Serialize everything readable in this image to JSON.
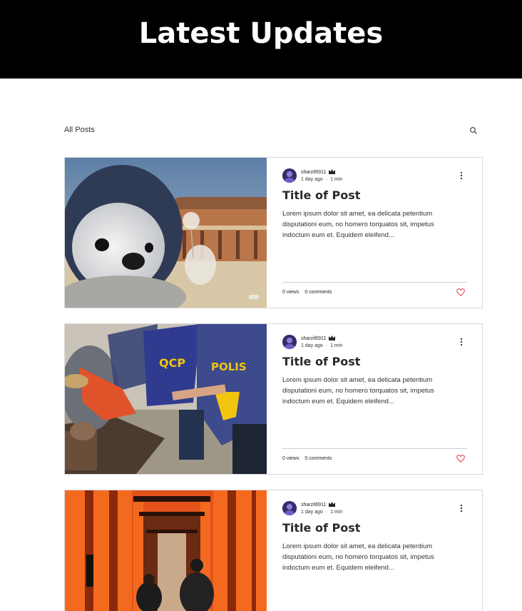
{
  "header": {
    "title": "Latest Updates"
  },
  "nav": {
    "all_posts": "All Posts",
    "search_icon": "search-icon"
  },
  "posts": [
    {
      "author": "sharzil6911",
      "time": "1 day ago",
      "read": "1 min",
      "title": "Title of Post",
      "excerpt": "Lorem ipsum dolor sit amet, ea delicata petentium disputationi eum, no homero torquatos sit, impetus indoctum eum et. Equidem eleifend...",
      "views": "0 views",
      "comments": "0 comments",
      "image": "penguin-photo"
    },
    {
      "author": "sharzil6911",
      "time": "1 day ago",
      "read": "1 min",
      "title": "Title of Post",
      "excerpt": "Lorem ipsum dolor sit amet, ea delicata petentium disputationi eum, no homero torquatos sit, impetus indoctum eum et. Equidem eleifend...",
      "views": "0 views",
      "comments": "0 comments",
      "image": "riot-police-photo"
    },
    {
      "author": "sharzil6911",
      "time": "1 day ago",
      "read": "1 min",
      "title": "Title of Post",
      "excerpt": "Lorem ipsum dolor sit amet, ea delicata petentium disputationi eum, no homero torquatos sit, impetus indoctum eum et. Equidem eleifend...",
      "views": "",
      "comments": "",
      "image": "torii-gates-photo"
    }
  ],
  "colors": {
    "header_bg": "#000000",
    "like": "#e8454d",
    "border": "#d9d9d9"
  }
}
